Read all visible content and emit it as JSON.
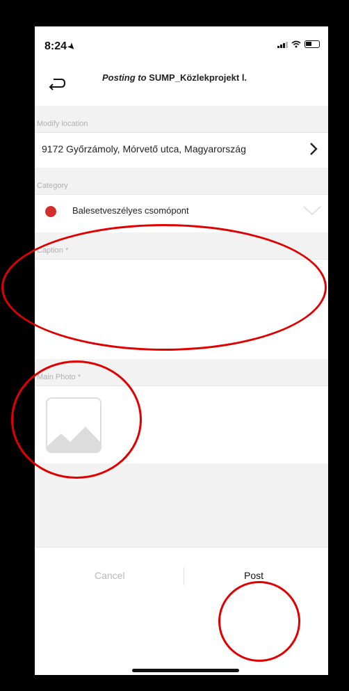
{
  "status_bar": {
    "time": "8:24"
  },
  "header": {
    "title_prefix": "Posting to",
    "title_target": "SUMP_Közlekprojekt l."
  },
  "form": {
    "location_label": "Modify location",
    "location_value": "9172 Győrzámoly, Mórvető utca, Magyarország",
    "category_label": "Category",
    "category_value": "Balesetveszélyes csomópont",
    "category_color": "#d3302a",
    "caption_label": "Caption *",
    "photo_label": "Main Photo *"
  },
  "footer": {
    "cancel_label": "Cancel",
    "post_label": "Post"
  },
  "annotation_color": "#e10000"
}
